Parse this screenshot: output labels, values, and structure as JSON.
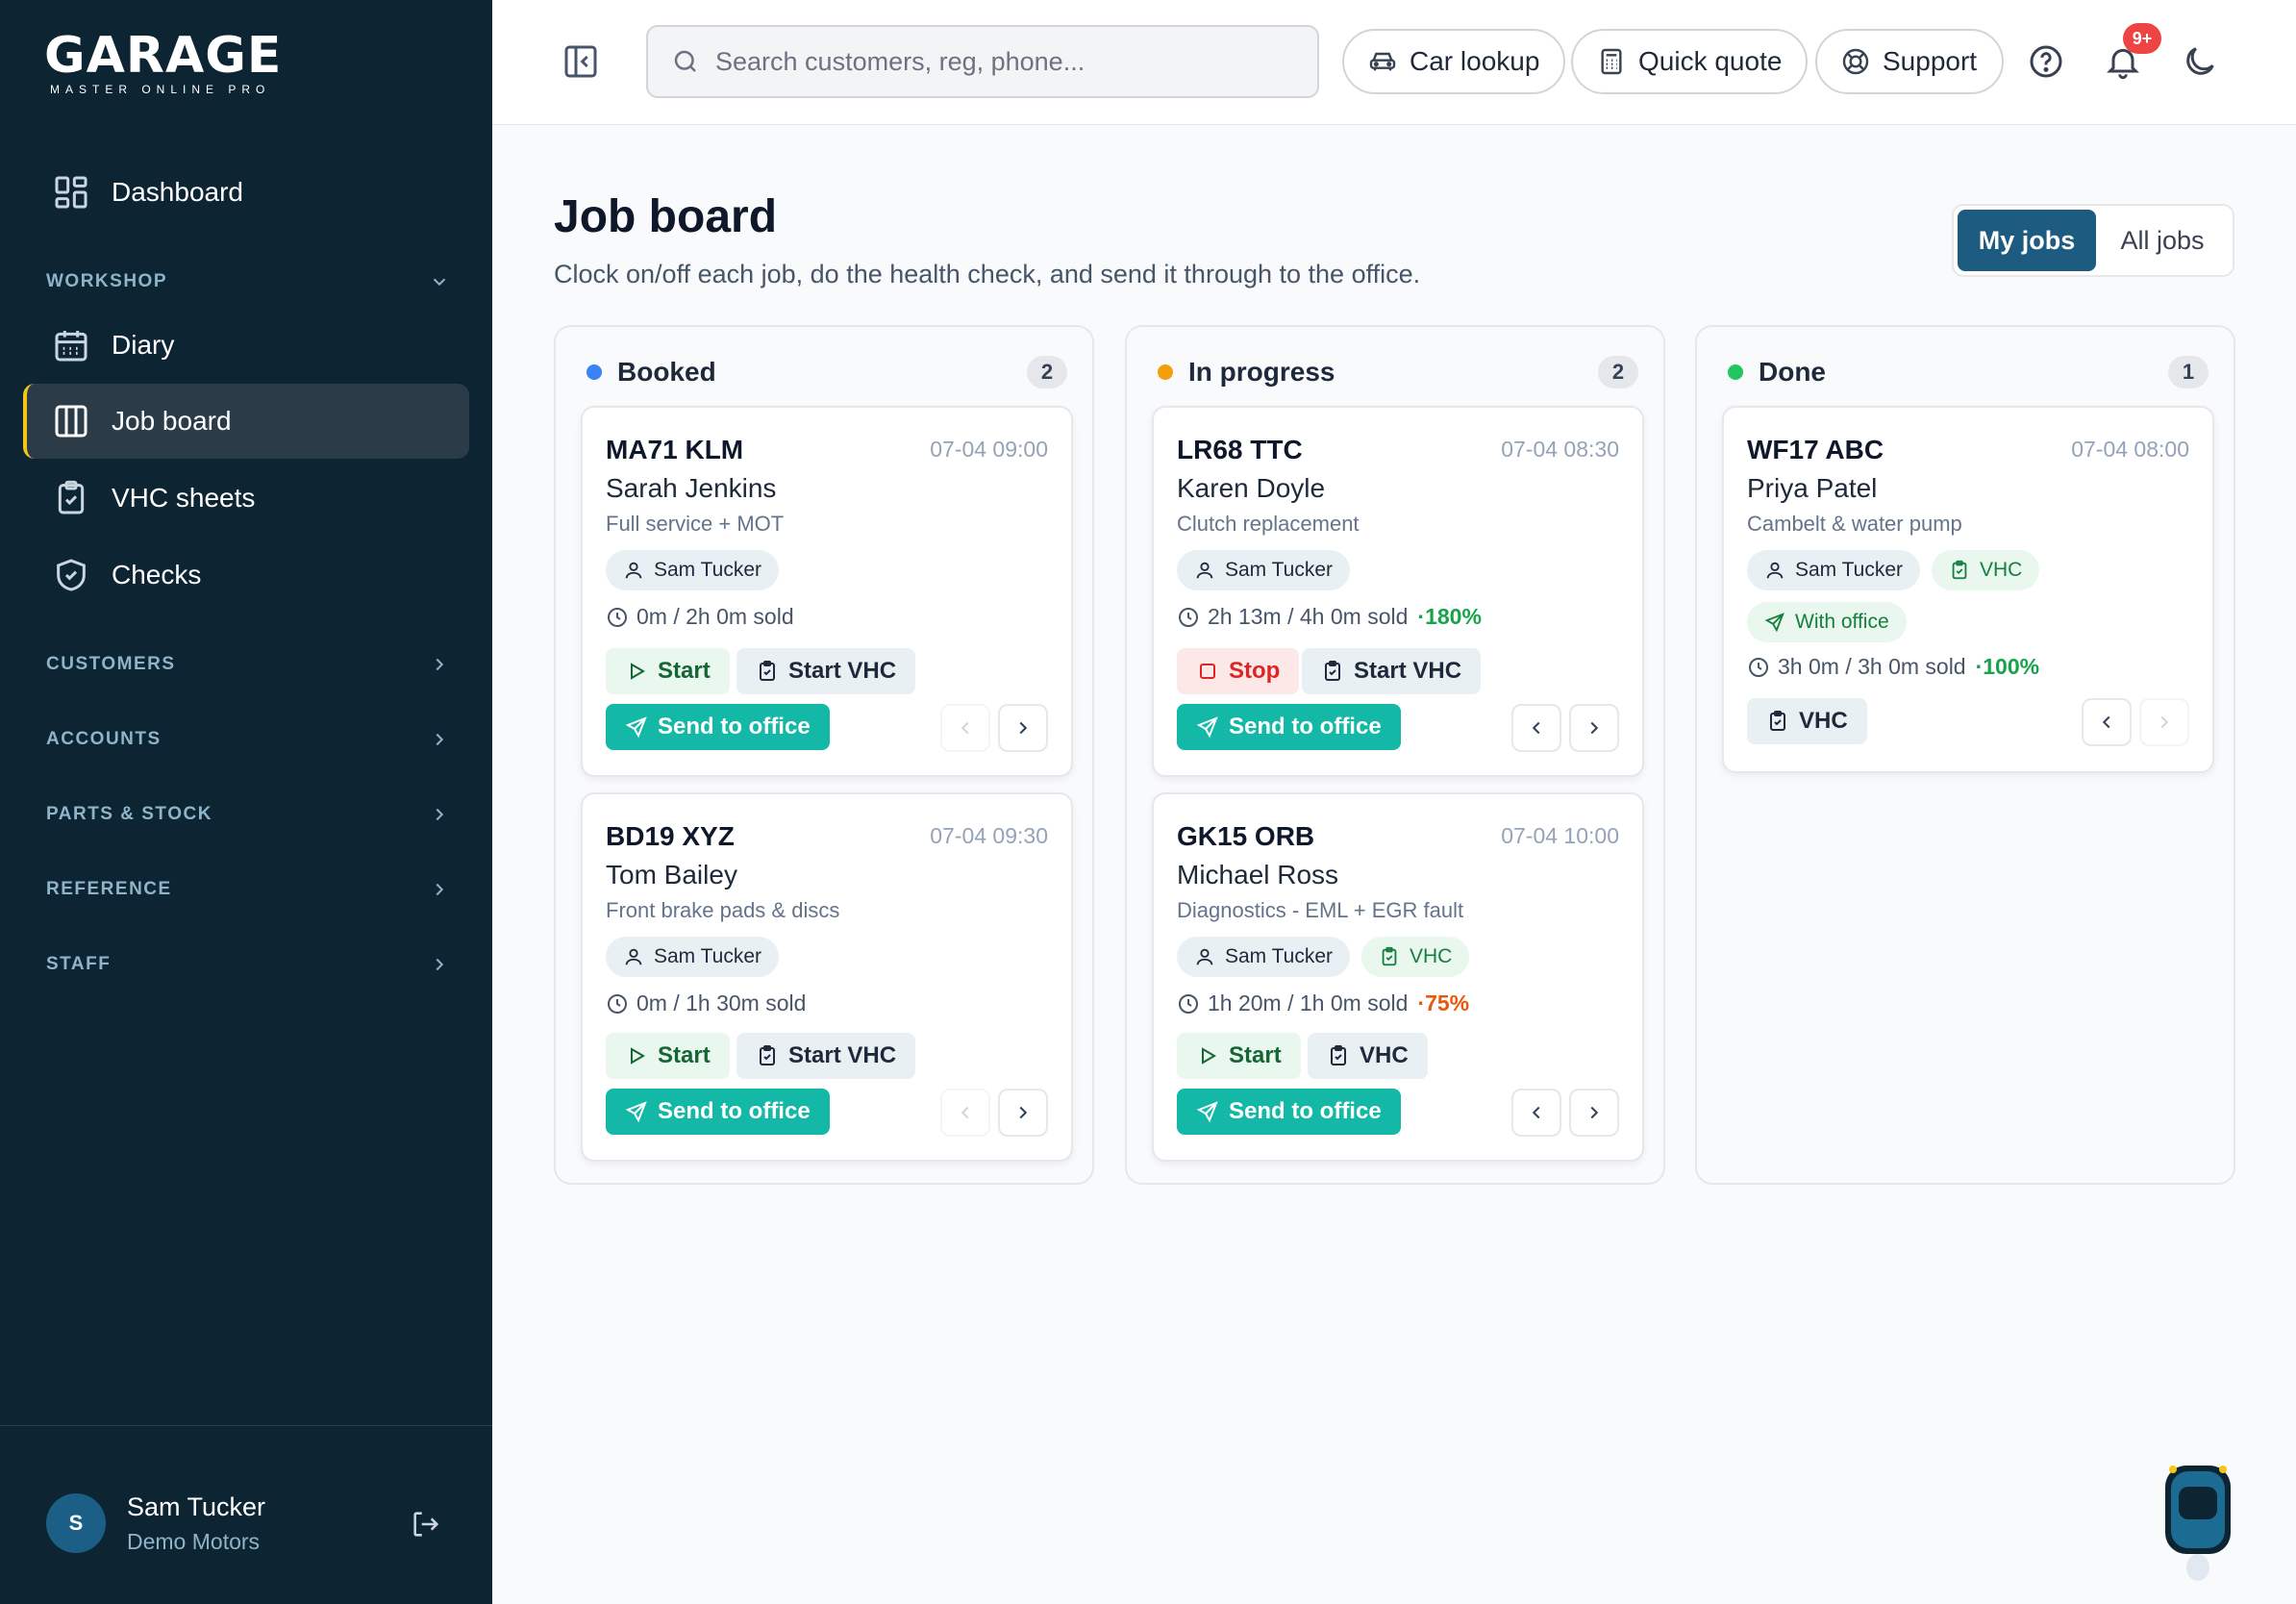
{
  "app": {
    "logo_main": "GARAGE",
    "logo_sub": "MASTER ONLINE PRO"
  },
  "sidebar": {
    "dashboard": "Dashboard",
    "workshop_section": "WORKSHOP",
    "items": [
      {
        "label": "Diary"
      },
      {
        "label": "Job board"
      },
      {
        "label": "VHC sheets"
      },
      {
        "label": "Checks"
      }
    ],
    "sections": [
      {
        "label": "CUSTOMERS"
      },
      {
        "label": "ACCOUNTS"
      },
      {
        "label": "PARTS & STOCK"
      },
      {
        "label": "REFERENCE"
      },
      {
        "label": "STAFF"
      }
    ],
    "user": {
      "initial": "S",
      "name": "Sam Tucker",
      "org": "Demo Motors"
    }
  },
  "topbar": {
    "search_placeholder": "Search customers, reg, phone...",
    "car_lookup": "Car lookup",
    "quick_quote": "Quick quote",
    "support": "Support",
    "notif_badge": "9+"
  },
  "page": {
    "title": "Job board",
    "subtitle": "Clock on/off each job, do the health check, and send it through to the office.",
    "toggle": {
      "my_jobs": "My jobs",
      "all_jobs": "All jobs"
    }
  },
  "colors": {
    "booked": "#3b82f6",
    "in_progress": "#f59e0b",
    "done": "#22c55e",
    "accent": "#1d5b80",
    "send": "#14b8a6"
  },
  "columns": [
    {
      "title": "Booked",
      "count": "2",
      "cards": [
        {
          "reg": "MA71 KLM",
          "time": "07-04 09:00",
          "customer": "Sarah Jenkins",
          "job": "Full service + MOT",
          "tech": "Sam Tucker",
          "hours": "0m / 2h 0m sold",
          "primary": "Start",
          "vhc": "Start VHC",
          "send": "Send to office"
        },
        {
          "reg": "BD19 XYZ",
          "time": "07-04 09:30",
          "customer": "Tom Bailey",
          "job": "Front brake pads & discs",
          "tech": "Sam Tucker",
          "hours": "0m / 1h 30m sold",
          "primary": "Start",
          "vhc": "Start VHC",
          "send": "Send to office"
        }
      ]
    },
    {
      "title": "In progress",
      "count": "2",
      "cards": [
        {
          "reg": "LR68 TTC",
          "time": "07-04 08:30",
          "customer": "Karen Doyle",
          "job": "Clutch replacement",
          "tech": "Sam Tucker",
          "hours": "2h 13m / 4h 0m sold",
          "pct": "·180%",
          "primary": "Stop",
          "vhc": "Start VHC",
          "send": "Send to office"
        },
        {
          "reg": "GK15 ORB",
          "time": "07-04 10:00",
          "customer": "Michael Ross",
          "job": "Diagnostics - EML + EGR fault",
          "tech": "Sam Tucker",
          "vhc_chip": "VHC",
          "hours": "1h 20m / 1h 0m sold",
          "pct": "·75%",
          "primary": "Start",
          "vhc": "VHC",
          "send": "Send to office"
        }
      ]
    },
    {
      "title": "Done",
      "count": "1",
      "cards": [
        {
          "reg": "WF17 ABC",
          "time": "07-04 08:00",
          "customer": "Priya Patel",
          "job": "Cambelt & water pump",
          "tech": "Sam Tucker",
          "vhc_chip": "VHC",
          "office_chip": "With office",
          "hours": "3h 0m / 3h 0m sold",
          "pct": "·100%",
          "vhc": "VHC"
        }
      ]
    }
  ]
}
